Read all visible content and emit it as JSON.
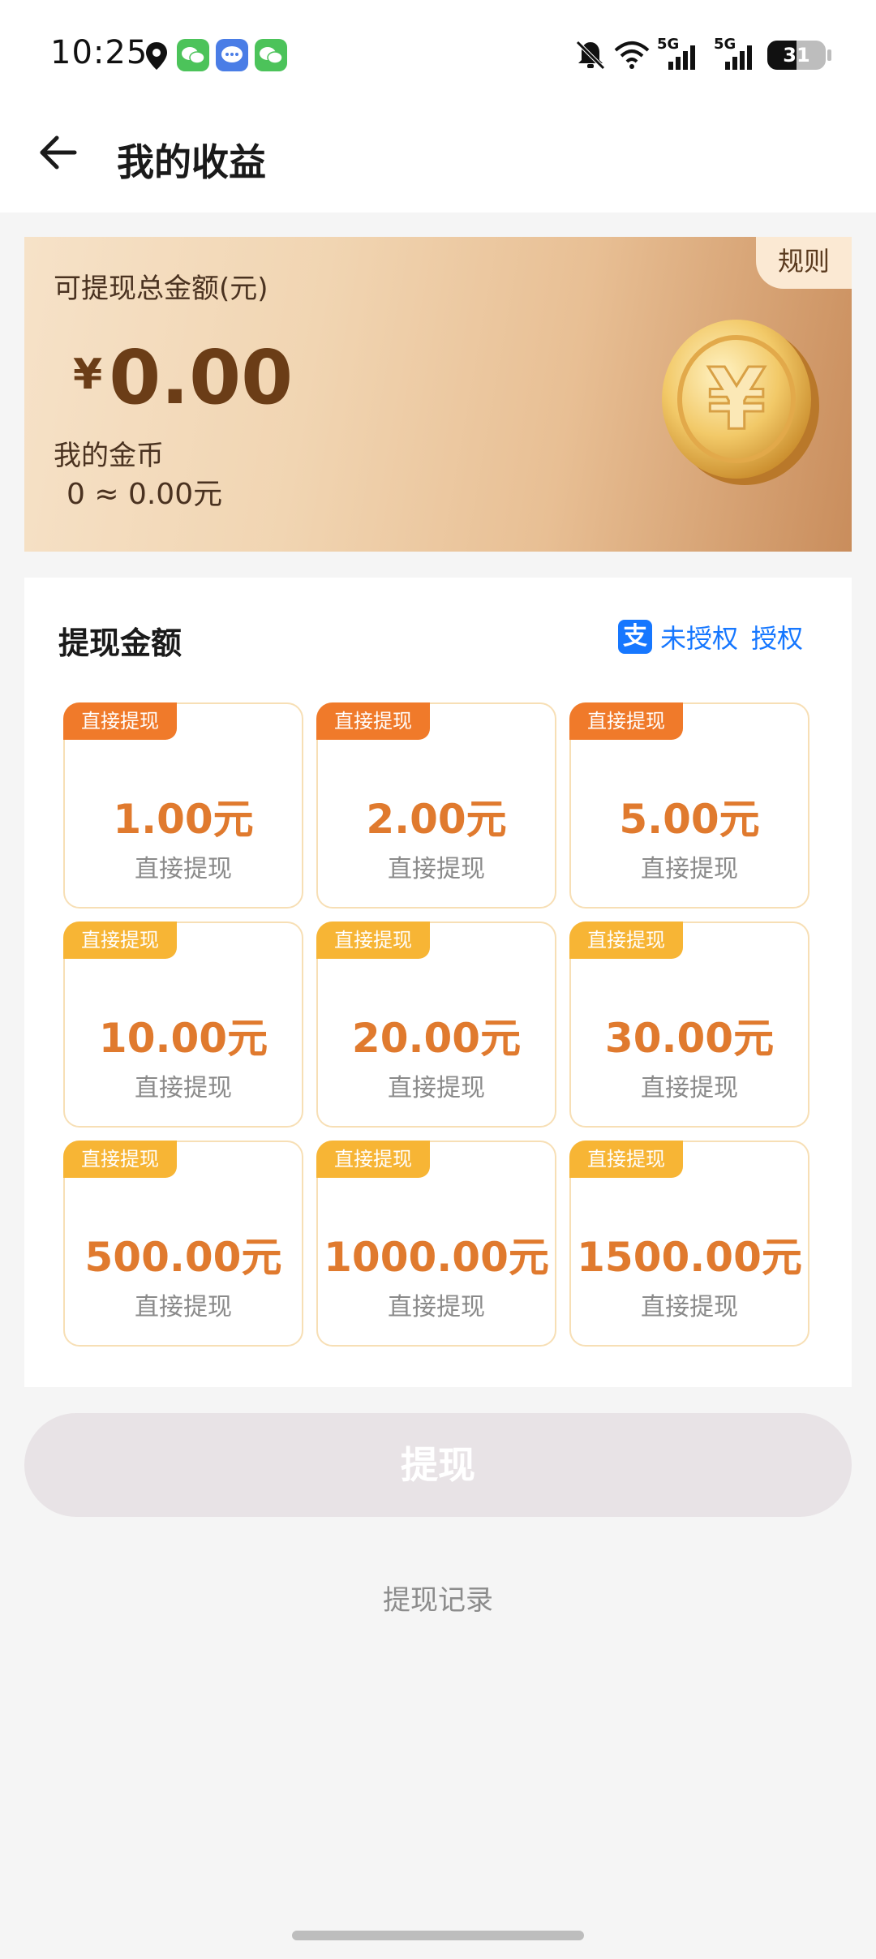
{
  "status_bar": {
    "time": "10:25",
    "battery": "31",
    "network_1": "5G",
    "network_2": "5G",
    "icons": [
      "location-icon",
      "wechat-icon",
      "message-icon",
      "wechat-icon",
      "bell-off-icon",
      "wifi-icon",
      "signal-icon",
      "battery-icon"
    ]
  },
  "header": {
    "title": "我的收益",
    "back_icon": "back-arrow-icon"
  },
  "earnings": {
    "rules_label": "规则",
    "total_label": "可提现总金额(元)",
    "currency_symbol": "¥",
    "total_amount": "0.00",
    "coins_label": "我的金币",
    "coins_value": "0 ≈ 0.00元"
  },
  "withdraw": {
    "title": "提现金额",
    "auth_status": "未授权",
    "auth_button": "授权",
    "options": [
      {
        "tag": "直接提现",
        "amount": "1.00元",
        "sub": "直接提现"
      },
      {
        "tag": "直接提现",
        "amount": "2.00元",
        "sub": "直接提现"
      },
      {
        "tag": "直接提现",
        "amount": "5.00元",
        "sub": "直接提现"
      },
      {
        "tag": "直接提现",
        "amount": "10.00元",
        "sub": "直接提现"
      },
      {
        "tag": "直接提现",
        "amount": "20.00元",
        "sub": "直接提现"
      },
      {
        "tag": "直接提现",
        "amount": "30.00元",
        "sub": "直接提现"
      },
      {
        "tag": "直接提现",
        "amount": "500.00元",
        "sub": "直接提现"
      },
      {
        "tag": "直接提现",
        "amount": "1000.00元",
        "sub": "直接提现"
      },
      {
        "tag": "直接提现",
        "amount": "1500.00元",
        "sub": "直接提现"
      }
    ],
    "button_label": "提现",
    "history_link": "提现记录"
  },
  "colors": {
    "accent_orange": "#e07a2e",
    "tag_dark": "#f07a2a",
    "tag_light": "#f7b535",
    "alipay_blue": "#1677ff"
  }
}
